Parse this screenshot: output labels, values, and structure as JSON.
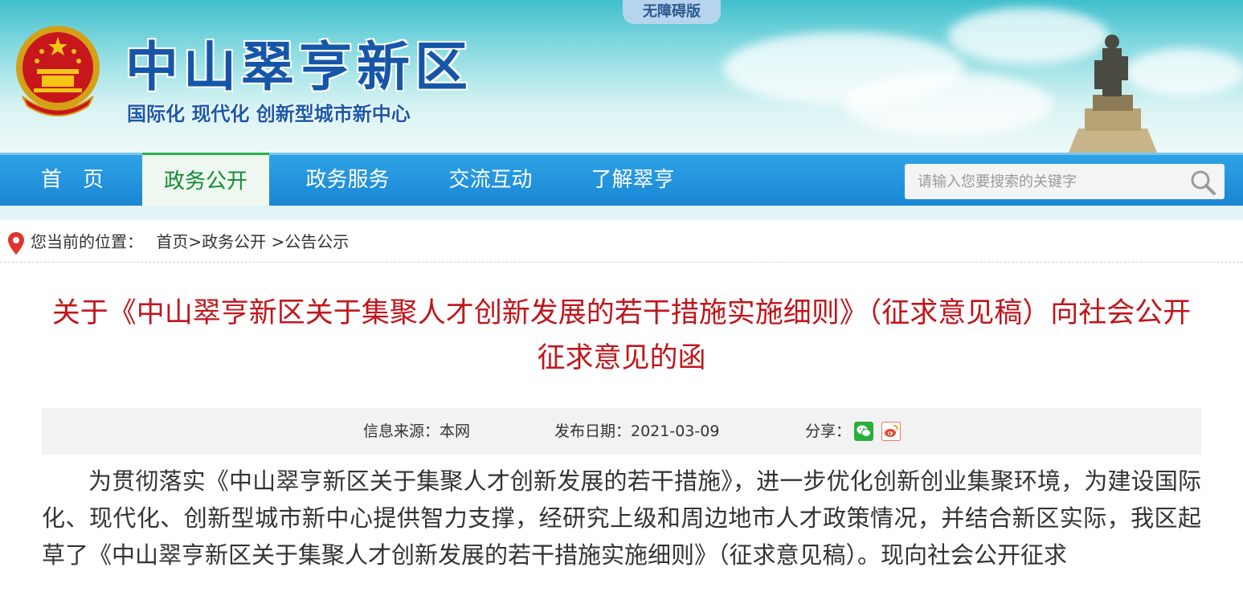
{
  "header": {
    "accessibility_label": "无障碍版",
    "site_title": "中山翠亨新区",
    "slogan": "国际化  现代化  创新型城市新中心"
  },
  "nav": {
    "items": [
      {
        "label": "首　页"
      },
      {
        "label": "政务公开"
      },
      {
        "label": "政务服务"
      },
      {
        "label": "交流互动"
      },
      {
        "label": "了解翠亨"
      }
    ],
    "active_index": 1
  },
  "search": {
    "placeholder": "请输入您要搜索的关键字"
  },
  "breadcrumb": {
    "prefix": "您当前的位置：",
    "path": "首页>政务公开 >公告公示"
  },
  "article": {
    "title": "关于《中山翠亨新区关于集聚人才创新发展的若干措施实施细则》（征求意见稿）向社会公开征求意见的函",
    "meta": {
      "source": "信息来源：本网",
      "date": "发布日期：2021-03-09",
      "share_label": "分享："
    },
    "body": "为贯彻落实《中山翠亨新区关于集聚人才创新发展的若干措施》，进一步优化创新创业集聚环境，为建设国际化、现代化、创新型城市新中心提供智力支撑，经研究上级和周边地市人才政策情况，并结合新区实际，我区起草了《中山翠亨新区关于集聚人才创新发展的若干措施实施细则》（征求意见稿）。现向社会公开征求"
  },
  "colors": {
    "title_red": "#c0161c",
    "nav_blue": "#1a86d4",
    "nav_active_green": "#138a34",
    "brand_blue": "#1656a8"
  }
}
